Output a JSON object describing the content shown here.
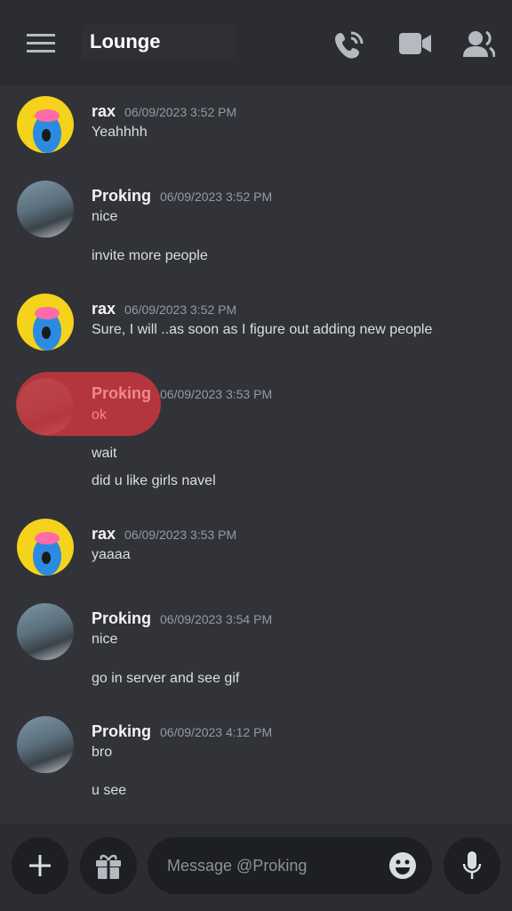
{
  "header": {
    "title": "Lounge",
    "icons": [
      "menu-icon",
      "voice-call-icon",
      "video-call-icon",
      "members-icon"
    ]
  },
  "messages": [
    {
      "author": "rax",
      "time": "06/09/2023 3:52 PM",
      "lines": [
        "Yeahhhh"
      ]
    },
    {
      "author": "Proking",
      "time": "06/09/2023 3:52 PM",
      "lines": [
        "nice",
        "invite more people"
      ]
    },
    {
      "author": "rax",
      "time": "06/09/2023 3:52 PM",
      "lines": [
        "Sure, I will ..as soon as I figure out adding new people"
      ]
    },
    {
      "author": "Proking",
      "time": "06/09/2023 3:53 PM",
      "lines": [
        "ok",
        "wait",
        "did u like girls navel"
      ],
      "highlighted": true,
      "highlight_color": "#c9373c"
    },
    {
      "author": "rax",
      "time": "06/09/2023 3:53 PM",
      "lines": [
        "yaaaa"
      ]
    },
    {
      "author": "Proking",
      "time": "06/09/2023 3:54 PM",
      "lines": [
        "nice",
        "go in server and see gif"
      ]
    },
    {
      "author": "Proking",
      "time": "06/09/2023 4:12 PM",
      "lines": [
        "bro",
        "u see"
      ]
    }
  ],
  "composer": {
    "placeholder": "Message @Proking",
    "icons": [
      "plus-icon",
      "gift-icon",
      "emoji-icon",
      "microphone-icon"
    ]
  },
  "colors": {
    "background": "#313338",
    "header": "#2b2d31",
    "input": "#1e1f22",
    "highlight": "#c9373c"
  }
}
